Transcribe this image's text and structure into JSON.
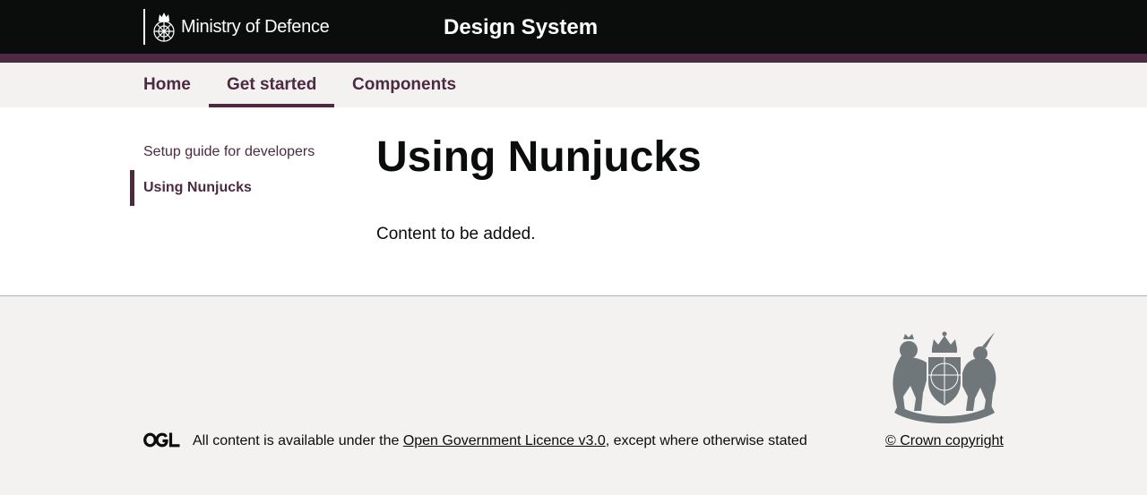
{
  "header": {
    "logo_text": "Ministry of Defence",
    "service_name": "Design System"
  },
  "nav": {
    "items": [
      {
        "label": "Home",
        "active": false
      },
      {
        "label": "Get started",
        "active": true
      },
      {
        "label": "Components",
        "active": false
      }
    ]
  },
  "sidebar": {
    "items": [
      {
        "label": "Setup guide for developers",
        "active": false
      },
      {
        "label": "Using Nunjucks",
        "active": true
      }
    ]
  },
  "main": {
    "title": "Using Nunjucks",
    "body": "Content to be added."
  },
  "footer": {
    "ogl_logo_icon": "ogl-logo-icon",
    "licence_prefix": "All content is available under the ",
    "licence_link": "Open Government Licence v3.0",
    "licence_suffix": ", except where otherwise stated",
    "crest_icon": "royal-coat-of-arms-icon",
    "copyright_link": "© Crown copyright"
  },
  "colors": {
    "header_bg": "#0b0c0c",
    "brand": "#4d2942",
    "nav_bg": "#f3f2f1",
    "footer_bg": "#f3f2f1",
    "crest_grey": "#6f777b"
  }
}
